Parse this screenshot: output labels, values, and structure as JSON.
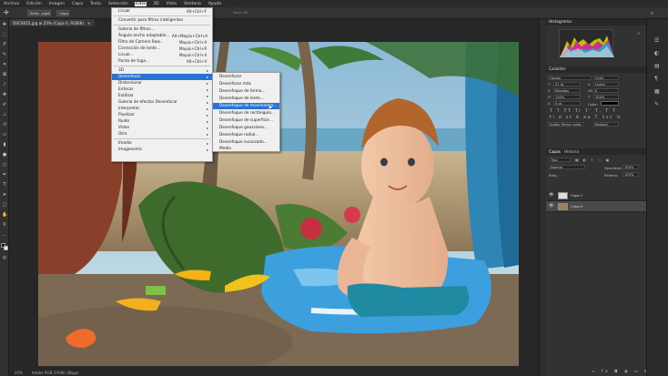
{
  "menubar": {
    "items": [
      "Archivo",
      "Edición",
      "Imagen",
      "Capa",
      "Texto",
      "Selección",
      "Filtro",
      "3D",
      "Vista",
      "Ventana",
      "Ayuda"
    ],
    "active_index": 6
  },
  "options_bar": {
    "mode_text": "Modo 3D:",
    "selected_label": "Selec. sujeto",
    "capa_label": "Capa"
  },
  "document_tab": {
    "title": "DSC0015.jpg al 25% (Capa 0, RGB/8)",
    "close": "×"
  },
  "filter_menu": {
    "items": [
      {
        "label": "Licuar",
        "shortcut": "Alt+Ctrl+F"
      },
      {
        "sep": true
      },
      {
        "label": "Convertir para filtros inteligentes"
      },
      {
        "sep": true
      },
      {
        "label": "Galería de filtros..."
      },
      {
        "label": "Ángulo ancho adaptable...",
        "shortcut": "Alt+Mayús+Ctrl+A"
      },
      {
        "label": "Filtro de Camera Raw...",
        "shortcut": "Mayús+Ctrl+A"
      },
      {
        "label": "Corrección de lente...",
        "shortcut": "Mayús+Ctrl+R"
      },
      {
        "label": "Licuar...",
        "shortcut": "Mayús+Ctrl+X"
      },
      {
        "label": "Punto de fuga...",
        "shortcut": "Alt+Ctrl+V"
      },
      {
        "sep": true
      },
      {
        "label": "3D",
        "submenu": true
      },
      {
        "label": "Desenfocar",
        "submenu": true,
        "highlight": true
      },
      {
        "label": "Distorsionar",
        "submenu": true
      },
      {
        "label": "Enfocar",
        "submenu": true
      },
      {
        "label": "Estilizar",
        "submenu": true
      },
      {
        "label": "Galería de efectos Desenfocar",
        "submenu": true
      },
      {
        "label": "Interpretar",
        "submenu": true
      },
      {
        "label": "Pixelizar",
        "submenu": true
      },
      {
        "label": "Ruido",
        "submenu": true
      },
      {
        "label": "Vídeo",
        "submenu": true
      },
      {
        "label": "Otro",
        "submenu": true
      },
      {
        "sep": true
      },
      {
        "label": "Imadio",
        "submenu": true
      },
      {
        "label": "Imagenomic",
        "submenu": true
      }
    ]
  },
  "blur_submenu": {
    "items": [
      {
        "label": "Desenfocar"
      },
      {
        "label": "Desenfocar más"
      },
      {
        "label": "Desenfoque de forma..."
      },
      {
        "label": "Desenfoque de lente..."
      },
      {
        "label": "Desenfoque de movimiento...",
        "highlight": true
      },
      {
        "label": "Desenfoque de rectángulo..."
      },
      {
        "label": "Desenfoque de superficie..."
      },
      {
        "label": "Desenfoque gaussiano..."
      },
      {
        "label": "Desenfoque radial..."
      },
      {
        "label": "Desenfoque suavizado..."
      },
      {
        "label": "Media"
      }
    ]
  },
  "histogram_panel": {
    "title": "Histograma"
  },
  "character_panel": {
    "title": "Carácter",
    "font_family": "Opcion",
    "font_style": "Cnd1",
    "size": "21 pt",
    "leading": "(Auto)",
    "kerning": "Medidas",
    "tracking": "0",
    "vscale": "100%",
    "hscale": "100%",
    "baseline": "0 pt",
    "color_label": "Color:",
    "language": "Inglés: Reino Unido",
    "antialias": "Redond."
  },
  "layers_panel": {
    "tab1": "Capas",
    "tab2": "Historia",
    "filter_kind": "Tipo",
    "blend_mode": "Normal",
    "opacity_label": "Opacidad:",
    "opacity_value": "100%",
    "lock_label": "Bloq.:",
    "fill_label": "Relleno:",
    "fill_value": "100%",
    "layers": [
      "Capa 1",
      "Capa 0"
    ]
  },
  "status": {
    "zoom": "25%",
    "doc_info": "Adobe RGB (1998) (8bpp)"
  },
  "colors": {
    "accent": "#2a73d6",
    "menu_bg": "#f0f0f0"
  }
}
